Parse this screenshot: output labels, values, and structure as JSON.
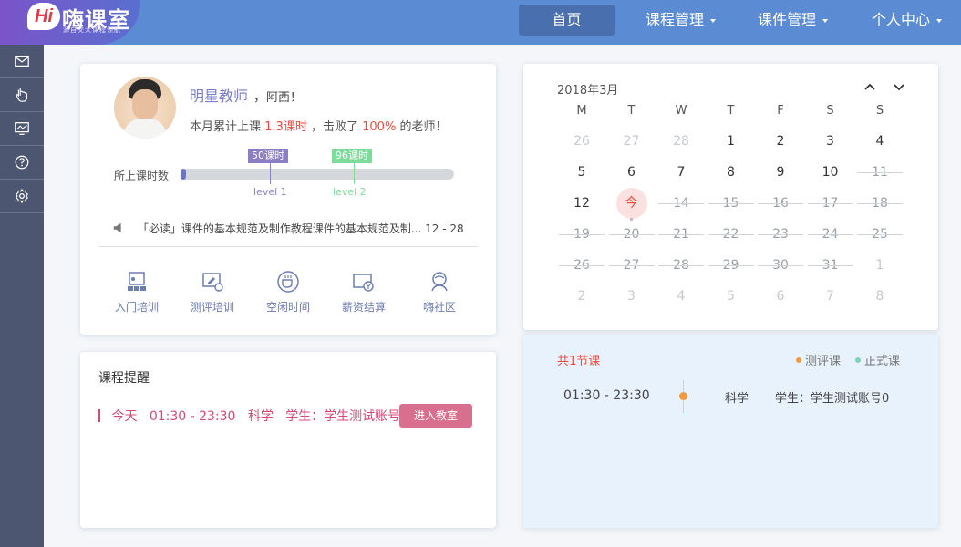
{
  "app": {
    "logo_mark": "Hi",
    "logo_name": "嗨课室",
    "logo_tagline": "源自交大课程领航"
  },
  "nav": {
    "items": [
      {
        "label": "首页",
        "active": true
      },
      {
        "label": "课程管理",
        "dropdown": true
      },
      {
        "label": "课件管理",
        "dropdown": true
      },
      {
        "label": "个人中心",
        "dropdown": true
      }
    ]
  },
  "sidebar": {
    "icons": [
      "mail-icon",
      "hand-pointer-icon",
      "monitor-icon",
      "help-icon",
      "gear-icon"
    ]
  },
  "profile": {
    "name": "明星教师",
    "separator": "，",
    "greeting": "阿西！",
    "stat_prefix": "本月累计上课",
    "stat_hours": "1.3课时",
    "stat_middle": "，击败了",
    "stat_percent": "100%",
    "stat_suffix": "的老师！",
    "progress_label": "所上课时数",
    "progress_fraction": 0.01,
    "milestones": [
      {
        "tag": "50课时",
        "level": "level 1",
        "color": "#8c7fc6"
      },
      {
        "tag": "96课时",
        "level": "level 2",
        "color": "#7ddc9a"
      }
    ],
    "notice_text": "「必读」课件的基本规范及制作教程课件的基本规范及制...",
    "notice_date": "12 - 28",
    "shortcuts": [
      {
        "label": "入门培训",
        "icon": "training-icon"
      },
      {
        "label": "测评培训",
        "icon": "assessment-icon"
      },
      {
        "label": "空闲时间",
        "icon": "coffee-icon"
      },
      {
        "label": "薪资结算",
        "icon": "salary-icon"
      },
      {
        "label": "嗨社区",
        "icon": "community-icon"
      }
    ]
  },
  "calendar": {
    "title": "2018年3月",
    "weekdays": [
      "M",
      "T",
      "W",
      "T",
      "F",
      "S",
      "S"
    ],
    "today_label": "今",
    "weeks": [
      [
        {
          "d": "26",
          "s": "grey"
        },
        {
          "d": "27",
          "s": "grey"
        },
        {
          "d": "28",
          "s": "grey"
        },
        {
          "d": "1",
          "s": "cur"
        },
        {
          "d": "2",
          "s": "cur"
        },
        {
          "d": "3",
          "s": "cur"
        },
        {
          "d": "4",
          "s": "cur"
        }
      ],
      [
        {
          "d": "5",
          "s": "cur"
        },
        {
          "d": "6",
          "s": "cur"
        },
        {
          "d": "7",
          "s": "cur"
        },
        {
          "d": "8",
          "s": "cur"
        },
        {
          "d": "9",
          "s": "cur"
        },
        {
          "d": "10",
          "s": "cur"
        },
        {
          "d": "11",
          "s": "past"
        }
      ],
      [
        {
          "d": "12",
          "s": "cur"
        },
        {
          "d": "今",
          "s": "today"
        },
        {
          "d": "14",
          "s": "past"
        },
        {
          "d": "15",
          "s": "past"
        },
        {
          "d": "16",
          "s": "past"
        },
        {
          "d": "17",
          "s": "past"
        },
        {
          "d": "18",
          "s": "past"
        }
      ],
      [
        {
          "d": "19",
          "s": "past"
        },
        {
          "d": "20",
          "s": "past"
        },
        {
          "d": "21",
          "s": "past"
        },
        {
          "d": "22",
          "s": "past"
        },
        {
          "d": "23",
          "s": "past"
        },
        {
          "d": "24",
          "s": "past"
        },
        {
          "d": "25",
          "s": "past"
        }
      ],
      [
        {
          "d": "26",
          "s": "past"
        },
        {
          "d": "27",
          "s": "past"
        },
        {
          "d": "28",
          "s": "past"
        },
        {
          "d": "29",
          "s": "past"
        },
        {
          "d": "30",
          "s": "past"
        },
        {
          "d": "31",
          "s": "past"
        },
        {
          "d": "1",
          "s": "grey"
        }
      ],
      [
        {
          "d": "2",
          "s": "grey"
        },
        {
          "d": "3",
          "s": "grey"
        },
        {
          "d": "4",
          "s": "grey"
        },
        {
          "d": "5",
          "s": "grey"
        },
        {
          "d": "6",
          "s": "grey"
        },
        {
          "d": "7",
          "s": "grey"
        },
        {
          "d": "8",
          "s": "grey"
        }
      ]
    ]
  },
  "reminder": {
    "title": "课程提醒",
    "day": "今天",
    "time": "01:30 - 23:30",
    "subject": "科学",
    "student": "学生：学生测试账号0",
    "button": "进入教室"
  },
  "schedule": {
    "count": "共1节课",
    "legend": [
      {
        "label": "测评课",
        "color": "#f49a3a"
      },
      {
        "label": "正式课",
        "color": "#7dd3b3"
      }
    ],
    "time": "01:30 - 23:30",
    "subject": "科学",
    "student": "学生：学生测试账号0"
  }
}
